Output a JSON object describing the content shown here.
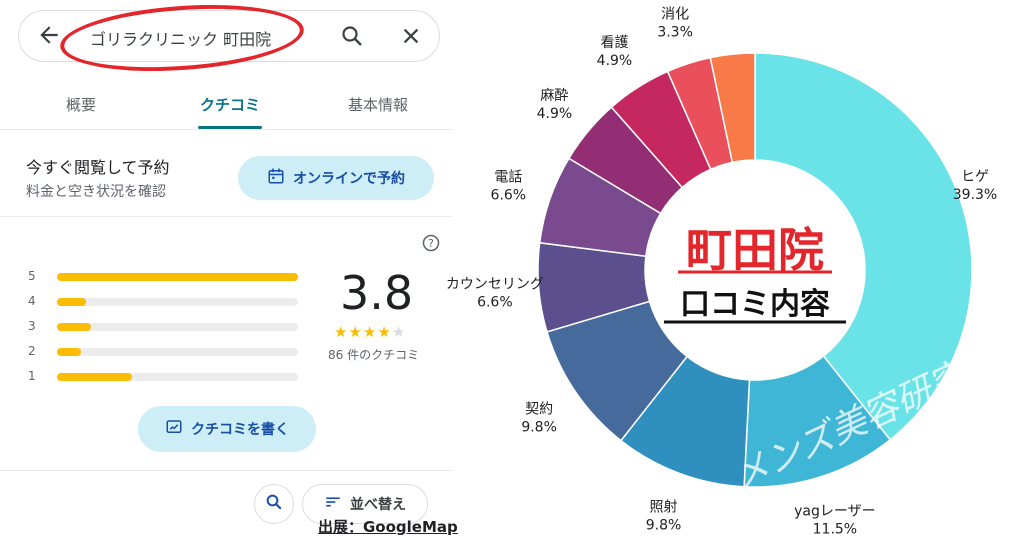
{
  "search": {
    "query": "ゴリラクリニック 町田院"
  },
  "tabs": [
    {
      "label": "概要"
    },
    {
      "label": "クチコミ"
    },
    {
      "label": "基本情報"
    }
  ],
  "reserve": {
    "title": "今すぐ閲覧して予約",
    "subtitle": "料金と空き状況を確認",
    "button_label": "オンラインで予約"
  },
  "ratings": {
    "score": "3.8",
    "stars": 4,
    "review_count": "86 件のクチコミ",
    "distribution": [
      {
        "star": "5",
        "fraction": 1.0
      },
      {
        "star": "4",
        "fraction": 0.12
      },
      {
        "star": "3",
        "fraction": 0.14
      },
      {
        "star": "2",
        "fraction": 0.1
      },
      {
        "star": "1",
        "fraction": 0.31
      }
    ]
  },
  "write_review_label": "クチコミを書く",
  "sort_label": "並べ替え",
  "source": "出展：GoogleMap",
  "colors": {
    "accent": "#0b7285",
    "star": "#fbbc04",
    "highlight": "#e3262b"
  },
  "chart_data": {
    "type": "pie",
    "title": "町田院",
    "subtitle": "口コミ内容",
    "watermark": "メンズ美容研究會",
    "slices": [
      {
        "label": "ヒゲ",
        "value": 39.3,
        "display": "39.3%",
        "color": "#6ae3e8"
      },
      {
        "label": "yagレーザー",
        "value": 11.5,
        "display": "11.5%",
        "color": "#3fb6d6"
      },
      {
        "label": "照射",
        "value": 9.8,
        "display": "9.8%",
        "color": "#2f8fbf"
      },
      {
        "label": "契約",
        "value": 9.8,
        "display": "9.8%",
        "color": "#476a9c"
      },
      {
        "label": "カウンセリング",
        "value": 6.6,
        "display": "6.6%",
        "color": "#5b4f8e"
      },
      {
        "label": "電話",
        "value": 6.6,
        "display": "6.6%",
        "color": "#7a4a8e"
      },
      {
        "label": "麻酔",
        "value": 4.9,
        "display": "4.9%",
        "color": "#932d74"
      },
      {
        "label": "看護",
        "value": 4.9,
        "display": "4.9%",
        "color": "#c4285f"
      },
      {
        "label": "消化",
        "value": 3.3,
        "display": "3.3%",
        "color": "#e9505c"
      },
      {
        "label": "",
        "value": 3.3,
        "display": "",
        "color": "#f77a48"
      }
    ]
  }
}
